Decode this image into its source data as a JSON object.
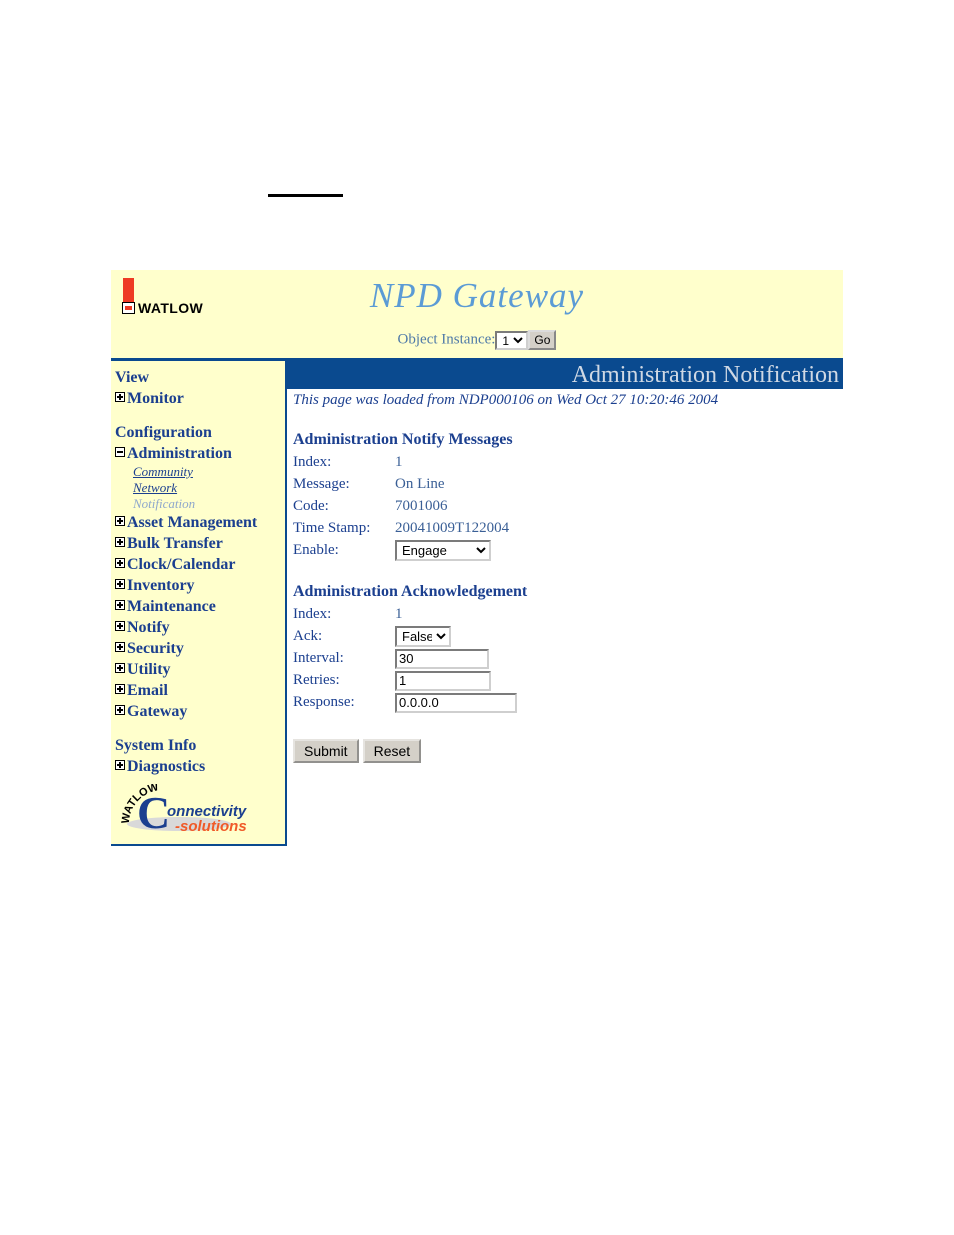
{
  "top_rule": "",
  "header": {
    "brand": "WATLOW",
    "title": "NPD Gateway",
    "instance_label": "Object Instance:",
    "instance_value": "1",
    "instance_options": [
      "1"
    ],
    "go_label": "Go",
    "bg_color": "#FFFFCC",
    "title_color": "#5B9BD5",
    "accent_color": "#0A4A8F"
  },
  "sidebar": {
    "groups": [
      {
        "head": "View",
        "items": [
          {
            "label": "Monitor",
            "toggle": "plus",
            "subitems": []
          }
        ]
      },
      {
        "head": "Configuration",
        "items": [
          {
            "label": "Administration",
            "toggle": "minus",
            "subitems": [
              {
                "label": "Community",
                "current": false
              },
              {
                "label": "Network",
                "current": false
              },
              {
                "label": "Notification",
                "current": true
              }
            ]
          },
          {
            "label": "Asset Management",
            "toggle": "plus",
            "subitems": []
          },
          {
            "label": "Bulk Transfer",
            "toggle": "plus",
            "subitems": []
          },
          {
            "label": "Clock/Calendar",
            "toggle": "plus",
            "subitems": []
          },
          {
            "label": "Inventory",
            "toggle": "plus",
            "subitems": []
          },
          {
            "label": "Maintenance",
            "toggle": "plus",
            "subitems": []
          },
          {
            "label": "Notify",
            "toggle": "plus",
            "subitems": []
          },
          {
            "label": "Security",
            "toggle": "plus",
            "subitems": []
          },
          {
            "label": "Utility",
            "toggle": "plus",
            "subitems": []
          },
          {
            "label": "Email",
            "toggle": "plus",
            "subitems": []
          },
          {
            "label": "Gateway",
            "toggle": "plus",
            "subitems": []
          }
        ]
      },
      {
        "head": "System Info",
        "items": [
          {
            "label": "Diagnostics",
            "toggle": "plus",
            "subitems": []
          }
        ]
      }
    ],
    "footer_logo": {
      "arc_text": "WATLOW",
      "big_letter": "C",
      "word1": "onnectivity",
      "word2": "-solutions",
      "word1_color": "#1B3F8F",
      "word2_color": "#F05A28"
    },
    "marker_color": "#E8481C"
  },
  "content": {
    "banner_title": "Administration Notification",
    "loaded_note": "This page was loaded from NDP000106 on Wed Oct 27 10:20:46 2004",
    "sections": [
      {
        "title": "Administration Notify Messages",
        "fields": [
          {
            "label": "Index:",
            "type": "static",
            "value": "1"
          },
          {
            "label": "Message:",
            "type": "static",
            "value": "On Line"
          },
          {
            "label": "Code:",
            "type": "static",
            "value": "7001006"
          },
          {
            "label": "Time Stamp:",
            "type": "static",
            "value": "20041009T122004"
          },
          {
            "label": "Enable:",
            "type": "select",
            "value": "Engage",
            "options": [
              "Engage"
            ]
          }
        ]
      },
      {
        "title": "Administration Acknowledgement",
        "fields": [
          {
            "label": "Index:",
            "type": "static",
            "value": "1"
          },
          {
            "label": "Ack:",
            "type": "select",
            "value": "False",
            "options": [
              "False"
            ]
          },
          {
            "label": "Interval:",
            "type": "input",
            "value": "30"
          },
          {
            "label": "Retries:",
            "type": "input",
            "value": "1"
          },
          {
            "label": "Response:",
            "type": "input",
            "value": "0.0.0.0"
          }
        ]
      }
    ],
    "submit_label": "Submit",
    "reset_label": "Reset"
  }
}
